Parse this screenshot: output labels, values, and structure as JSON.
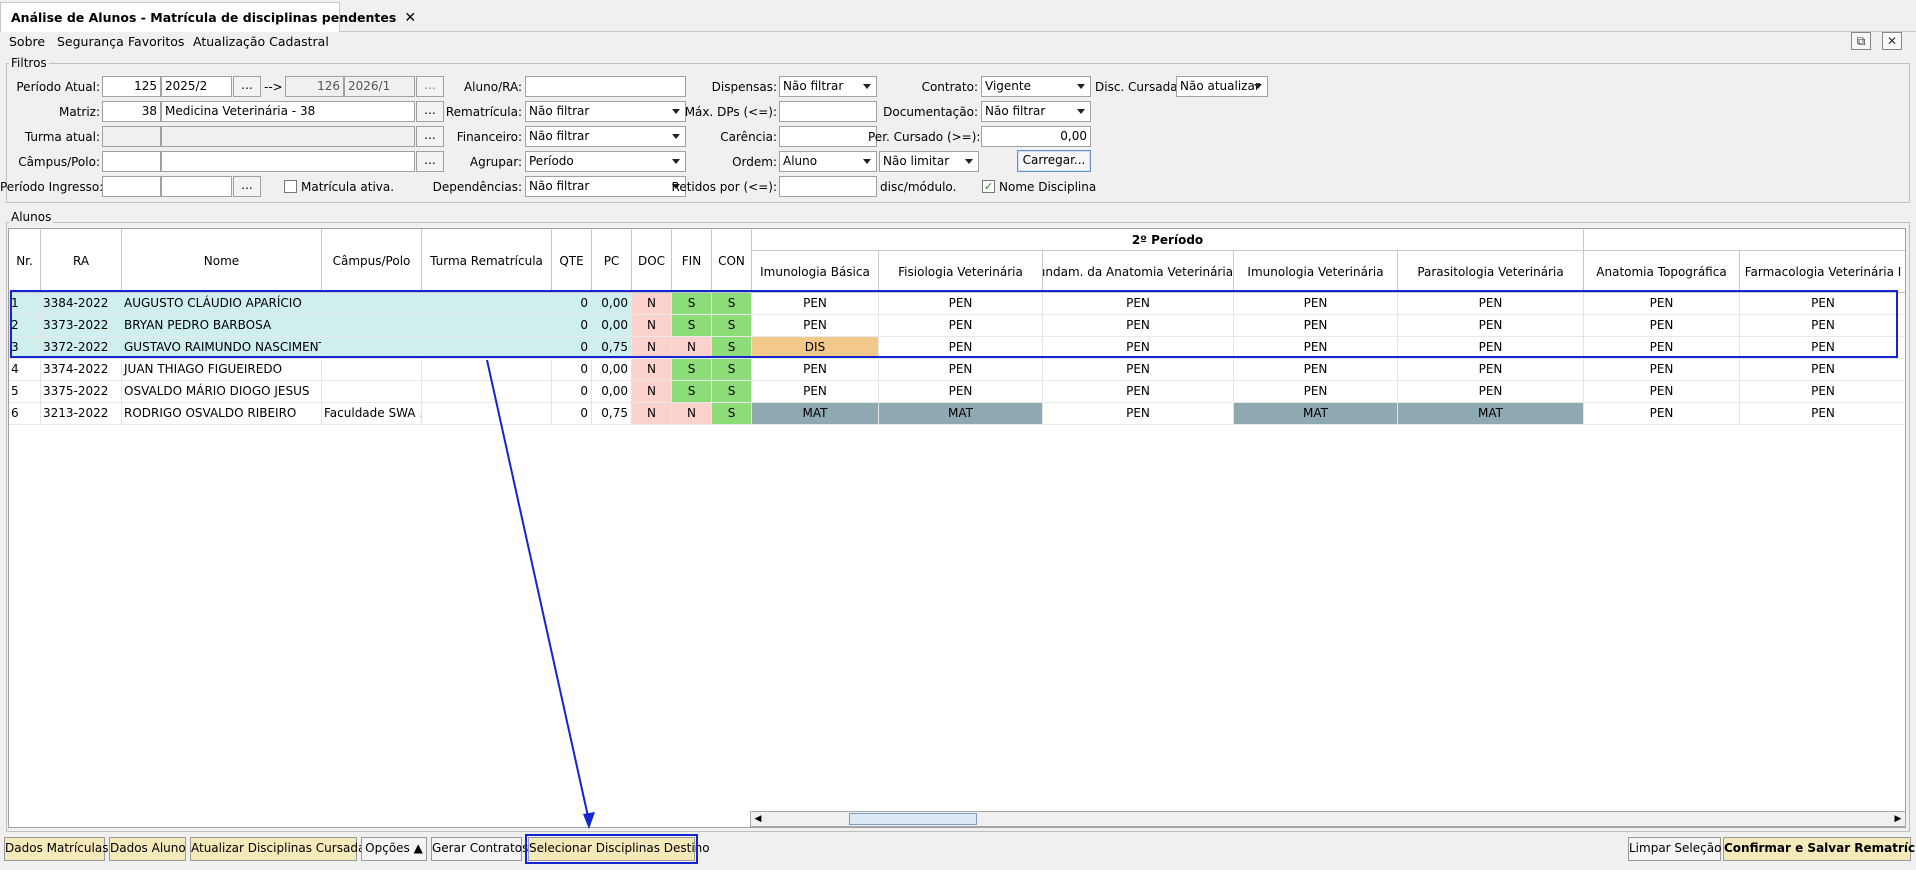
{
  "tab": {
    "title": "Análise de Alunos - Matrícula de disciplinas pendentes"
  },
  "menu": [
    "Sobre",
    "Segurança",
    "Favoritos",
    "Atualização Cadastral"
  ],
  "filters": {
    "title": "Filtros",
    "periodo_atual_label": "Período Atual:",
    "periodo_atual_code": "125",
    "periodo_atual_value": "2025/2",
    "arrow": "-->",
    "periodo_dest_code": "126",
    "periodo_dest_value": "2026/1",
    "matriz_label": "Matriz:",
    "matriz_code": "38",
    "matriz_value": "Medicina Veterinária - 38",
    "turma_label": "Turma atual:",
    "campus_label": "Câmpus/Polo:",
    "ingresso_label": "Período Ingresso:",
    "matricula_ativa_label": "Matrícula ativa.",
    "aluno_label": "Aluno/RA:",
    "rematricula_label": "Rematrícula:",
    "rematricula_value": "Não filtrar",
    "financeiro_label": "Financeiro:",
    "financeiro_value": "Não filtrar",
    "agrupar_label": "Agrupar:",
    "agrupar_value": "Período",
    "dependencias_label": "Dependências:",
    "dependencias_value": "Não filtrar",
    "dispensas_label": "Dispensas:",
    "dispensas_value": "Não filtrar",
    "max_dps_label": "Máx. DPs (<=):",
    "carencia_label": "Carência:",
    "ordem_label": "Ordem:",
    "ordem_value": "Aluno",
    "limite_value": "Não limitar",
    "retidos_label": "Retidos por (<=):",
    "retidos_suffix": "disc/módulo.",
    "contrato_label": "Contrato:",
    "contrato_value": "Vigente",
    "documentacao_label": "Documentação:",
    "documentacao_value": "Não filtrar",
    "per_cursado_label": "Per. Cursado (>=):",
    "per_cursado_value": "0,00",
    "carregar_button": "Carregar...",
    "nome_disciplina_label": "Nome Disciplina",
    "disc_cursadas_label": "Disc. Cursadas:",
    "disc_cursadas_value": "Não atualizar",
    "ellipsis": "..."
  },
  "students_group": {
    "title": "Alunos"
  },
  "columns": {
    "nr": "Nr.",
    "ra": "RA",
    "nome": "Nome",
    "campus": "Câmpus/Polo",
    "turma": "Turma Rematrícula",
    "qte": "QTE",
    "pc": "PC",
    "doc": "DOC",
    "fin": "FIN",
    "con": "CON",
    "period_group": "2º Período",
    "disciplines": [
      "Imunologia Básica",
      "Fisiologia Veterinária",
      "Fundam. da Anatomia Veterinária...",
      "Imunologia Veterinária",
      "Parasitologia Veterinária",
      "Anatomia Topográfica",
      "Farmacologia Veterinária I"
    ]
  },
  "rows": [
    {
      "nr": "1",
      "ra": "3384-2022",
      "nome": "AUGUSTO CLÁUDIO APARÍCIO",
      "campus": "",
      "turma": "",
      "qte": "0",
      "pc": "0,00",
      "doc": "N",
      "fin": "S",
      "con": "S",
      "disc": [
        "PEN",
        "PEN",
        "PEN",
        "PEN",
        "PEN",
        "PEN",
        "PEN"
      ]
    },
    {
      "nr": "2",
      "ra": "3373-2022",
      "nome": "BRYAN PEDRO BARBOSA",
      "campus": "",
      "turma": "",
      "qte": "0",
      "pc": "0,00",
      "doc": "N",
      "fin": "S",
      "con": "S",
      "disc": [
        "PEN",
        "PEN",
        "PEN",
        "PEN",
        "PEN",
        "PEN",
        "PEN"
      ]
    },
    {
      "nr": "3",
      "ra": "3372-2022",
      "nome": "GUSTAVO RAIMUNDO NASCIMENTO",
      "campus": "",
      "turma": "",
      "qte": "0",
      "pc": "0,75",
      "doc": "N",
      "fin": "N",
      "con": "S",
      "disc": [
        "DIS",
        "PEN",
        "PEN",
        "PEN",
        "PEN",
        "PEN",
        "PEN"
      ]
    },
    {
      "nr": "4",
      "ra": "3374-2022",
      "nome": "JUAN THIAGO FIGUEIREDO",
      "campus": "",
      "turma": "",
      "qte": "0",
      "pc": "0,00",
      "doc": "N",
      "fin": "S",
      "con": "S",
      "disc": [
        "PEN",
        "PEN",
        "PEN",
        "PEN",
        "PEN",
        "PEN",
        "PEN"
      ]
    },
    {
      "nr": "5",
      "ra": "3375-2022",
      "nome": "OSVALDO MÁRIO DIOGO JESUS",
      "campus": "",
      "turma": "",
      "qte": "0",
      "pc": "0,00",
      "doc": "N",
      "fin": "S",
      "con": "S",
      "disc": [
        "PEN",
        "PEN",
        "PEN",
        "PEN",
        "PEN",
        "PEN",
        "PEN"
      ]
    },
    {
      "nr": "6",
      "ra": "3213-2022",
      "nome": "RODRIGO OSVALDO RIBEIRO",
      "campus": "Faculdade SWA ...",
      "turma": "",
      "qte": "0",
      "pc": "0,75",
      "doc": "N",
      "fin": "N",
      "con": "S",
      "disc": [
        "MAT",
        "MAT",
        "PEN",
        "MAT",
        "MAT",
        "PEN",
        "PEN"
      ]
    }
  ],
  "bottom_buttons": {
    "dados_matriculas": "Dados Matrículas",
    "dados_aluno": "Dados Aluno",
    "atualizar": "Atualizar Disciplinas Cursadas",
    "opcoes": "Opções ▲",
    "gerar": "Gerar Contratos",
    "selecionar": "Selecionar Disciplinas Destino",
    "limpar": "Limpar Seleção",
    "confirmar": "Confirmar e Salvar Rematrículas"
  },
  "colors": {
    "highlight": "#1424d0",
    "selected_row": "#cfeeee",
    "green": "#8cdc78",
    "pink": "#fbd3cc",
    "dis": "#f2c98a",
    "mat": "#8fa9b3"
  }
}
